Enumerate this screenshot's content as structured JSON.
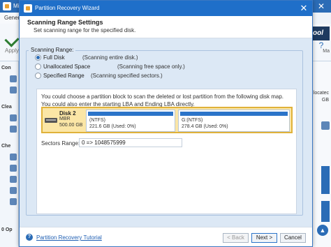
{
  "background": {
    "title": "Mi",
    "close_glyph": "✕",
    "tab_general": "Gener",
    "apply_label": "Apply",
    "logo_text": "ool",
    "help_glyph": "?",
    "manual_label": "Ma",
    "left_items": [
      "Con",
      "Clea",
      "Che",
      "0 Op"
    ],
    "right_items": [
      "locatec",
      "GB"
    ],
    "up_glyph": "▲"
  },
  "dialog": {
    "title": "Partition Recovery Wizard",
    "close_glyph": "✕",
    "heading": "Scanning Range Settings",
    "subheading": "Set scanning range for the specified disk.",
    "group_label": "Scanning Range:",
    "options": [
      {
        "label": "Full Disk",
        "desc": "(Scanning entire disk.)",
        "checked": true
      },
      {
        "label": "Unallocated Space",
        "desc": "(Scanning free space only.)",
        "checked": false
      },
      {
        "label": "Specified Range",
        "desc": "(Scanning specified sectors.)",
        "checked": false
      }
    ],
    "info_text": "You could choose a partition block to scan the deleted or lost partition from the following disk map. You could also enter the starting LBA and Ending LBA directly.",
    "disk": {
      "name": "Disk 2",
      "type": "MBR",
      "size": "500.00 GB",
      "partitions": [
        {
          "name": "(NTFS)",
          "usage": "221.6 GB (Used: 0%)"
        },
        {
          "name": "G:(NTFS)",
          "usage": "278.4 GB (Used: 0%)"
        }
      ]
    },
    "sectors_label": "Sectors Range:",
    "sectors_value": "0 => 1048575999",
    "tutorial_link": "Partition Recovery Tutorial",
    "tutorial_icon": "?",
    "buttons": {
      "back": "< Back",
      "next": "Next >",
      "cancel": "Cancel"
    }
  },
  "colors": {
    "titlebar": "#1f6fc9",
    "selection_highlight": "#fbe6a6",
    "partition_bar": "#2b74c9"
  }
}
